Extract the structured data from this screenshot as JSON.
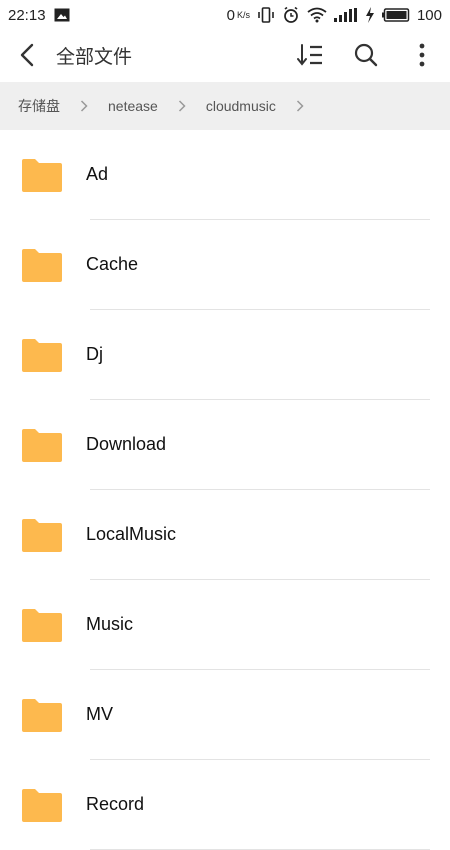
{
  "status_bar": {
    "time": "22:13",
    "speed_value": "0",
    "speed_unit": "K/s",
    "battery": "100"
  },
  "app_bar": {
    "title": "全部文件",
    "icons": [
      "back-icon",
      "sort-icon",
      "search-icon",
      "more-icon"
    ]
  },
  "breadcrumb": {
    "items": [
      "存储盘",
      "netease",
      "cloudmusic"
    ]
  },
  "folders": [
    {
      "name": "Ad"
    },
    {
      "name": "Cache"
    },
    {
      "name": "Dj"
    },
    {
      "name": "Download"
    },
    {
      "name": "LocalMusic"
    },
    {
      "name": "Music"
    },
    {
      "name": "MV"
    },
    {
      "name": "Record"
    }
  ],
  "colors": {
    "folder": "#FDB94E",
    "breadcrumb_bg": "#efefef",
    "divider": "#e3e3e3"
  }
}
